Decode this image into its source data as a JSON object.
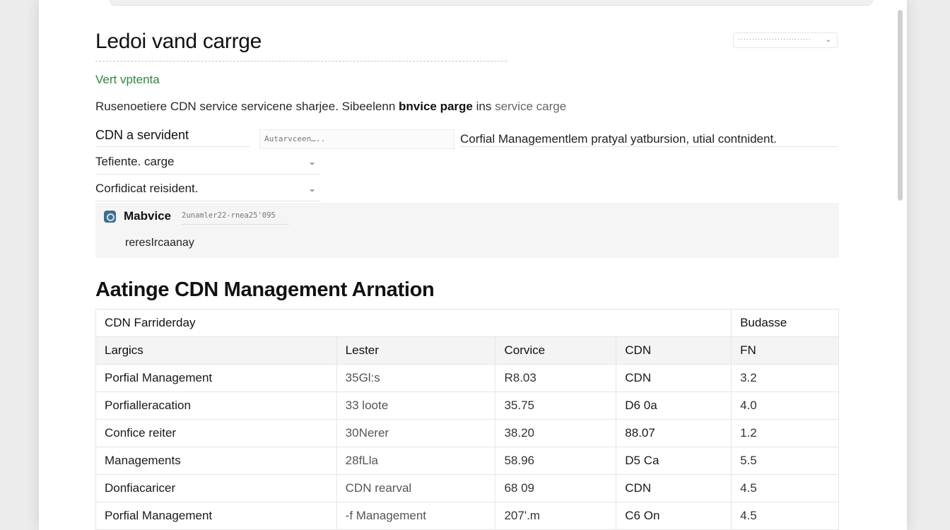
{
  "page": {
    "title": "Ledoi vand carrge",
    "subtitle": "Vert vptenta",
    "description": {
      "part1": "Rusenoetiere CDN service servicene sharjee. Sibeelenn ",
      "bold": "bnvice parge",
      "part2": " ins ",
      "muted": "service carge"
    },
    "top_select_placeholder": "··························"
  },
  "form": {
    "field_label": "CDN a servident",
    "input_value": "Autarvceen…..",
    "field_note": "Corfial Managementlem pratyal yatbursion, utial contnident.",
    "dropdowns": [
      {
        "label": "Tefiente. carge"
      },
      {
        "label": "Corfidicat reisident."
      }
    ]
  },
  "notice": {
    "name": "Mabvice",
    "stamp": "2unamler22-rnea25'095",
    "body": "reresIrcaanay"
  },
  "table": {
    "section_title": "Aatinge CDN Management Arnation",
    "group_header": {
      "left": "CDN Farriderday",
      "right": "Budasse"
    },
    "columns": [
      "Largics",
      "Lester",
      "Corvice",
      "CDN",
      "FN"
    ],
    "rows": [
      [
        "Porfial Management",
        "35Gl:s",
        "R8.03",
        "CDN",
        "3.2"
      ],
      [
        "Porfialleracation",
        "33 loote",
        "35.75",
        "D6 0a",
        "4.0"
      ],
      [
        "Confice reiter",
        "30Nerer",
        "38.20",
        "88.07",
        "1.2"
      ],
      [
        "Managements",
        "28fLla",
        "58.96",
        "D5 Ca",
        "5.5"
      ],
      [
        "Donfiacaricer",
        "CDN rearval",
        "68 09",
        "CDN",
        "4.5"
      ],
      [
        "Porfial Management",
        "-f Management",
        "207'.m",
        "C6 On",
        "4.5"
      ]
    ]
  },
  "colors": {
    "accent_green": "#2b8a3e",
    "notice_bg": "#f5f5f5",
    "icon_blue": "#3c6f8f"
  }
}
